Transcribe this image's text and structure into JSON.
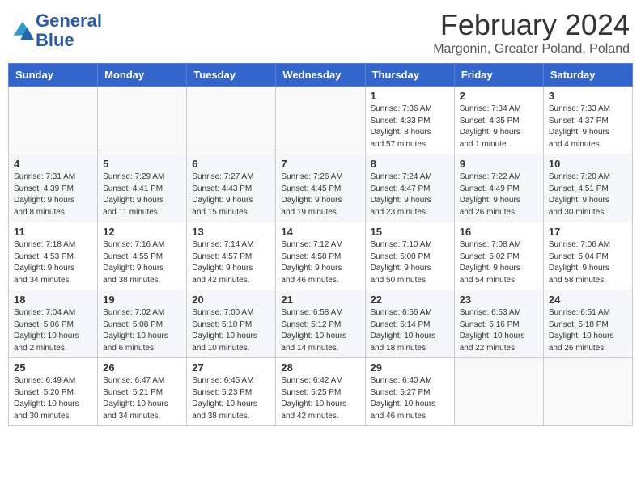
{
  "header": {
    "title": "February 2024",
    "subtitle": "Margonin, Greater Poland, Poland",
    "logo_line1": "General",
    "logo_line2": "Blue"
  },
  "columns": [
    "Sunday",
    "Monday",
    "Tuesday",
    "Wednesday",
    "Thursday",
    "Friday",
    "Saturday"
  ],
  "weeks": [
    [
      {
        "day": "",
        "info": ""
      },
      {
        "day": "",
        "info": ""
      },
      {
        "day": "",
        "info": ""
      },
      {
        "day": "",
        "info": ""
      },
      {
        "day": "1",
        "info": "Sunrise: 7:36 AM\nSunset: 4:33 PM\nDaylight: 8 hours\nand 57 minutes."
      },
      {
        "day": "2",
        "info": "Sunrise: 7:34 AM\nSunset: 4:35 PM\nDaylight: 9 hours\nand 1 minute."
      },
      {
        "day": "3",
        "info": "Sunrise: 7:33 AM\nSunset: 4:37 PM\nDaylight: 9 hours\nand 4 minutes."
      }
    ],
    [
      {
        "day": "4",
        "info": "Sunrise: 7:31 AM\nSunset: 4:39 PM\nDaylight: 9 hours\nand 8 minutes."
      },
      {
        "day": "5",
        "info": "Sunrise: 7:29 AM\nSunset: 4:41 PM\nDaylight: 9 hours\nand 11 minutes."
      },
      {
        "day": "6",
        "info": "Sunrise: 7:27 AM\nSunset: 4:43 PM\nDaylight: 9 hours\nand 15 minutes."
      },
      {
        "day": "7",
        "info": "Sunrise: 7:26 AM\nSunset: 4:45 PM\nDaylight: 9 hours\nand 19 minutes."
      },
      {
        "day": "8",
        "info": "Sunrise: 7:24 AM\nSunset: 4:47 PM\nDaylight: 9 hours\nand 23 minutes."
      },
      {
        "day": "9",
        "info": "Sunrise: 7:22 AM\nSunset: 4:49 PM\nDaylight: 9 hours\nand 26 minutes."
      },
      {
        "day": "10",
        "info": "Sunrise: 7:20 AM\nSunset: 4:51 PM\nDaylight: 9 hours\nand 30 minutes."
      }
    ],
    [
      {
        "day": "11",
        "info": "Sunrise: 7:18 AM\nSunset: 4:53 PM\nDaylight: 9 hours\nand 34 minutes."
      },
      {
        "day": "12",
        "info": "Sunrise: 7:16 AM\nSunset: 4:55 PM\nDaylight: 9 hours\nand 38 minutes."
      },
      {
        "day": "13",
        "info": "Sunrise: 7:14 AM\nSunset: 4:57 PM\nDaylight: 9 hours\nand 42 minutes."
      },
      {
        "day": "14",
        "info": "Sunrise: 7:12 AM\nSunset: 4:58 PM\nDaylight: 9 hours\nand 46 minutes."
      },
      {
        "day": "15",
        "info": "Sunrise: 7:10 AM\nSunset: 5:00 PM\nDaylight: 9 hours\nand 50 minutes."
      },
      {
        "day": "16",
        "info": "Sunrise: 7:08 AM\nSunset: 5:02 PM\nDaylight: 9 hours\nand 54 minutes."
      },
      {
        "day": "17",
        "info": "Sunrise: 7:06 AM\nSunset: 5:04 PM\nDaylight: 9 hours\nand 58 minutes."
      }
    ],
    [
      {
        "day": "18",
        "info": "Sunrise: 7:04 AM\nSunset: 5:06 PM\nDaylight: 10 hours\nand 2 minutes."
      },
      {
        "day": "19",
        "info": "Sunrise: 7:02 AM\nSunset: 5:08 PM\nDaylight: 10 hours\nand 6 minutes."
      },
      {
        "day": "20",
        "info": "Sunrise: 7:00 AM\nSunset: 5:10 PM\nDaylight: 10 hours\nand 10 minutes."
      },
      {
        "day": "21",
        "info": "Sunrise: 6:58 AM\nSunset: 5:12 PM\nDaylight: 10 hours\nand 14 minutes."
      },
      {
        "day": "22",
        "info": "Sunrise: 6:56 AM\nSunset: 5:14 PM\nDaylight: 10 hours\nand 18 minutes."
      },
      {
        "day": "23",
        "info": "Sunrise: 6:53 AM\nSunset: 5:16 PM\nDaylight: 10 hours\nand 22 minutes."
      },
      {
        "day": "24",
        "info": "Sunrise: 6:51 AM\nSunset: 5:18 PM\nDaylight: 10 hours\nand 26 minutes."
      }
    ],
    [
      {
        "day": "25",
        "info": "Sunrise: 6:49 AM\nSunset: 5:20 PM\nDaylight: 10 hours\nand 30 minutes."
      },
      {
        "day": "26",
        "info": "Sunrise: 6:47 AM\nSunset: 5:21 PM\nDaylight: 10 hours\nand 34 minutes."
      },
      {
        "day": "27",
        "info": "Sunrise: 6:45 AM\nSunset: 5:23 PM\nDaylight: 10 hours\nand 38 minutes."
      },
      {
        "day": "28",
        "info": "Sunrise: 6:42 AM\nSunset: 5:25 PM\nDaylight: 10 hours\nand 42 minutes."
      },
      {
        "day": "29",
        "info": "Sunrise: 6:40 AM\nSunset: 5:27 PM\nDaylight: 10 hours\nand 46 minutes."
      },
      {
        "day": "",
        "info": ""
      },
      {
        "day": "",
        "info": ""
      }
    ]
  ]
}
